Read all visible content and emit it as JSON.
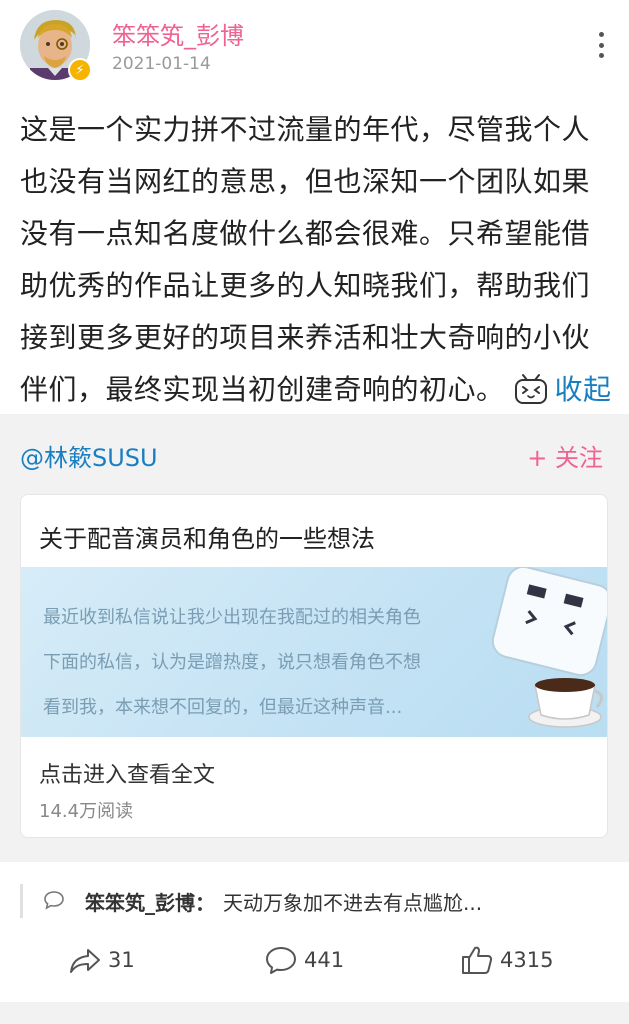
{
  "post": {
    "username": "笨笨笂_彭博",
    "date": "2021-01-14",
    "text": "这是一个实力拼不过流量的年代，尽管我个人也没有当网红的意思，但也深知一个团队如果没有一点知名度做什么都会很难。只希望能借助优秀的作品让更多的人知晓我们，帮助我们接到更多更好的项目来养活和壮大奇响的小伙伴们，最终实现当初创建奇响的初心。",
    "collapse_label": "收起"
  },
  "repost": {
    "user": "@林簌SUSU",
    "follow_label": "+ 关注",
    "card": {
      "title": "关于配音演员和角色的一些想法",
      "banner_lines": [
        "最近收到私信说让我少出现在我配过的相关角色",
        "下面的私信，认为是蹭热度，说只想看角色不想",
        "看到我，本来想不回复的，但最近这种声音..."
      ],
      "link_text": "点击进入查看全文",
      "reads": "14.4万阅读"
    }
  },
  "comment": {
    "user": "笨笨笂_彭博：",
    "text": "天动万象加不进去有点尴尬..."
  },
  "actions": {
    "share_count": "31",
    "comment_count": "441",
    "like_count": "4315"
  },
  "icons": {
    "more": "more-vertical-icon",
    "badge": "verified-lightning-icon",
    "share": "share-arrow-icon",
    "comment": "comment-bubble-icon",
    "like": "thumbs-up-icon"
  },
  "colors": {
    "username": "#f06292",
    "link": "#1a7fc1",
    "follow": "#f06292",
    "badge": "#f5b400",
    "repost_bg": "#f2f2f2"
  }
}
